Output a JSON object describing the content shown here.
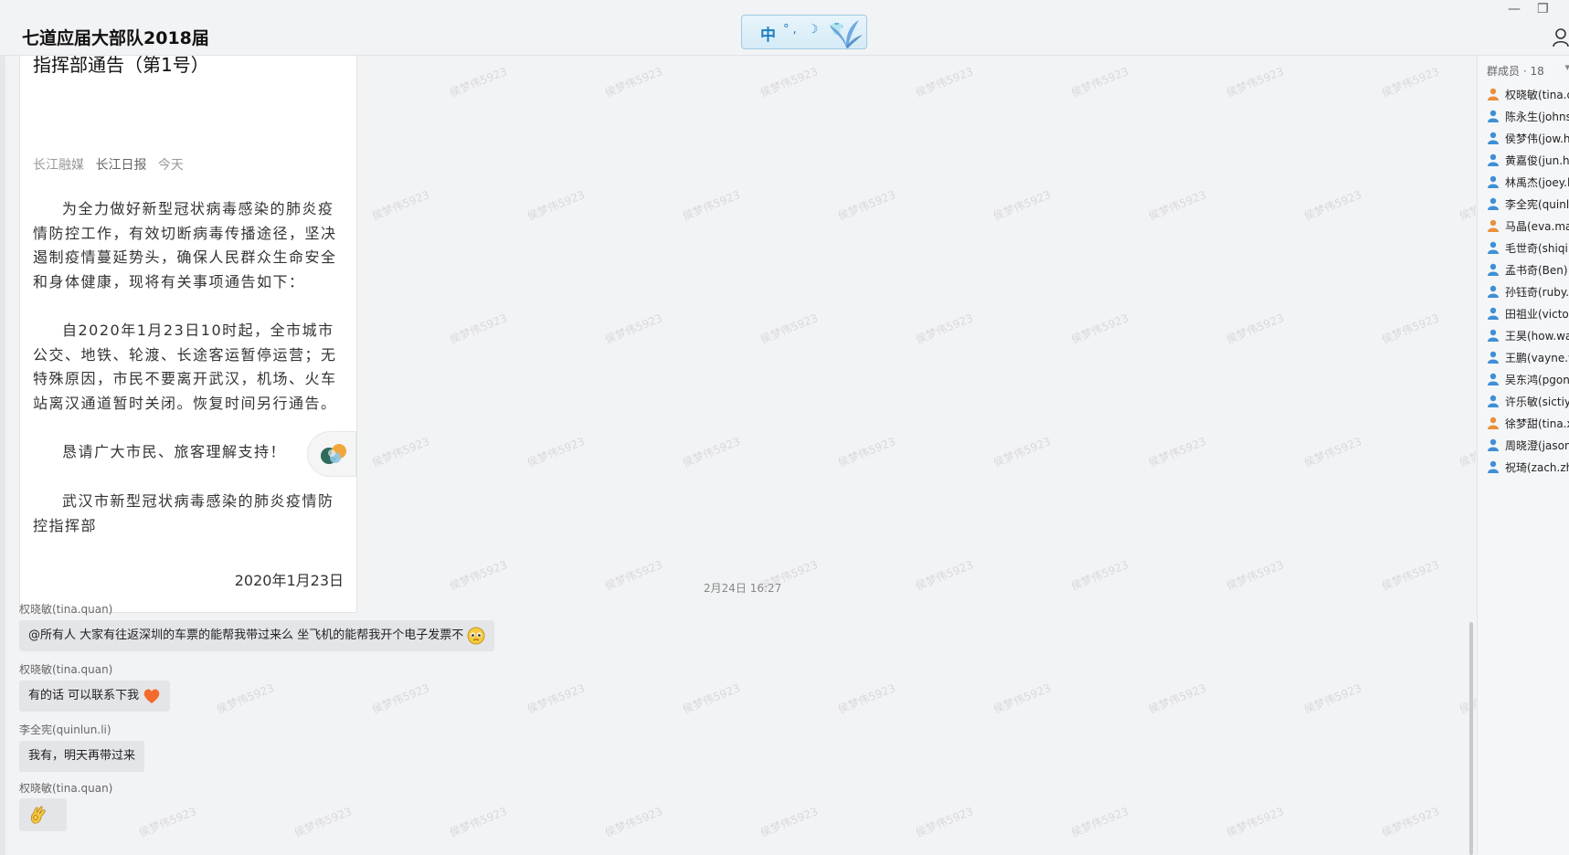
{
  "window": {
    "title": "七道应届大部队2018届",
    "ime": {
      "mode": "中",
      "symbols": "°, ☽ 👕"
    }
  },
  "watermark": "侯梦伟5923",
  "article": {
    "headline_cut": "…………………………………………",
    "headline": "指挥部通告（第1号）",
    "source1": "长江融媒",
    "source2": "长江日报",
    "time": "今天",
    "p1": "为全力做好新型冠状病毒感染的肺炎疫情防控工作，有效切断病毒传播途径，坚决遏制疫情蔓延势头，确保人民群众生命安全和身体健康，现将有关事项通告如下：",
    "p2": "自2020年1月23日10时起，全市城市公交、地铁、轮渡、长途客运暂停运营；无特殊原因，市民不要离开武汉，机场、火车站离汉通道暂时关闭。恢复时间另行通告。",
    "p3": "恳请广大市民、旅客理解支持！",
    "p4": "武汉市新型冠状病毒感染的肺炎疫情防控指挥部",
    "date": "2020年1月23日"
  },
  "timestamp": "2月24日 16:27",
  "messages": [
    {
      "sender": "权晓敏(tina.quan)",
      "text": "@所有人  大家有往返深圳的车票的能帮我带过来么  坐飞机的能帮我开个电子发票不",
      "emoji": "pleading-face"
    },
    {
      "sender": "权晓敏(tina.quan)",
      "text": "有的话 可以联系下我",
      "emoji": "orange-heart"
    },
    {
      "sender": "李全宪(quinlun.li)",
      "text": "我有，明天再带过来",
      "emoji": ""
    },
    {
      "sender": "权晓敏(tina.quan)",
      "text": "",
      "emoji": "ok-hand"
    }
  ],
  "members": {
    "header": "群成员 · 18",
    "list": [
      {
        "name": "权晓敏(tina.q",
        "color": "#e8913a"
      },
      {
        "name": "陈永生(johns",
        "color": "#3f8fd6"
      },
      {
        "name": "侯梦伟(jow.h",
        "color": "#3f8fd6"
      },
      {
        "name": "黄嘉俊(jun.hu",
        "color": "#3f8fd6"
      },
      {
        "name": "林禹杰(joey.l",
        "color": "#3f8fd6"
      },
      {
        "name": "李全宪(quinl",
        "color": "#3f8fd6"
      },
      {
        "name": "马晶(eva.ma)",
        "color": "#e8913a"
      },
      {
        "name": "毛世奇(shiqi.",
        "color": "#3f8fd6"
      },
      {
        "name": "孟书奇(Ben)",
        "color": "#3f8fd6"
      },
      {
        "name": "孙钰奇(ruby.",
        "color": "#3f8fd6"
      },
      {
        "name": "田祖业(victor",
        "color": "#3f8fd6"
      },
      {
        "name": "王昊(how.wa",
        "color": "#3f8fd6"
      },
      {
        "name": "王鹏(vayne.w",
        "color": "#3f8fd6"
      },
      {
        "name": "吴东鸿(pgon",
        "color": "#3f8fd6"
      },
      {
        "name": "许乐敏(sictiy.",
        "color": "#3f8fd6"
      },
      {
        "name": "徐梦甜(tina.x",
        "color": "#e8913a"
      },
      {
        "name": "周晓澄(jason",
        "color": "#3f8fd6"
      },
      {
        "name": "祝琦(zach.zh",
        "color": "#3f8fd6"
      }
    ]
  }
}
